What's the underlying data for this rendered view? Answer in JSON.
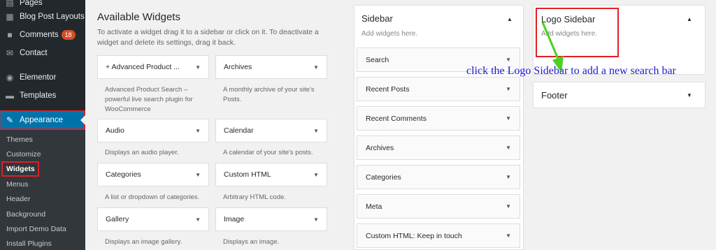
{
  "sidebar_menu": {
    "items": [
      {
        "label": "Pages",
        "icon": "pages-icon"
      },
      {
        "label": "Blog Post Layouts",
        "icon": "layout-icon"
      },
      {
        "label": "Comments",
        "icon": "comments-icon",
        "badge": "18"
      },
      {
        "label": "Contact",
        "icon": "mail-icon"
      },
      {
        "label": "Elementor",
        "icon": "elementor-icon"
      },
      {
        "label": "Templates",
        "icon": "folder-icon"
      },
      {
        "label": "Appearance",
        "icon": "paintbrush-icon"
      }
    ],
    "submenu": [
      "Themes",
      "Customize",
      "Widgets",
      "Menus",
      "Header",
      "Background",
      "Import Demo Data",
      "Install Plugins"
    ]
  },
  "available_widgets": {
    "title": "Available Widgets",
    "description_line1": "To activate a widget drag it to a sidebar or click on it. To deactivate a",
    "description_line2": "widget and delete its settings, drag it back.",
    "widgets": [
      {
        "name": "+ Advanced Product ...",
        "desc1": "Advanced Product Search –",
        "desc2": "powerful live search plugin for",
        "desc3": "WooCommerce"
      },
      {
        "name": "Archives",
        "desc1": "A monthly archive of your site's",
        "desc2": "Posts.",
        "desc3": ""
      },
      {
        "name": "Audio",
        "desc1": "Displays an audio player.",
        "desc2": "",
        "desc3": ""
      },
      {
        "name": "Calendar",
        "desc1": "A calendar of your site's posts.",
        "desc2": "",
        "desc3": ""
      },
      {
        "name": "Categories",
        "desc1": "A list or dropdown of categories.",
        "desc2": "",
        "desc3": ""
      },
      {
        "name": "Custom HTML",
        "desc1": "Arbitrary HTML code.",
        "desc2": "",
        "desc3": ""
      },
      {
        "name": "Gallery",
        "desc1": "Displays an image gallery.",
        "desc2": "",
        "desc3": ""
      },
      {
        "name": "Image",
        "desc1": "Displays an image.",
        "desc2": "",
        "desc3": ""
      }
    ]
  },
  "sidebar_area": {
    "title": "Sidebar",
    "subtitle": "Add widgets here.",
    "widgets": [
      "Search",
      "Recent Posts",
      "Recent Comments",
      "Archives",
      "Categories",
      "Meta",
      "Custom HTML: Keep in touch"
    ]
  },
  "logo_sidebar": {
    "title": "Logo Sidebar",
    "subtitle": "Add widgets here."
  },
  "footer_area": {
    "title": "Footer"
  },
  "annotation": {
    "text": "click the Logo Sidebar to add a new search bar"
  },
  "colors": {
    "admin_menu_bg": "#23282d",
    "active_blue": "#0073aa",
    "highlight_red": "#e11f26",
    "annotation_blue": "#1d19c9",
    "arrow_green": "#4cd11f"
  }
}
